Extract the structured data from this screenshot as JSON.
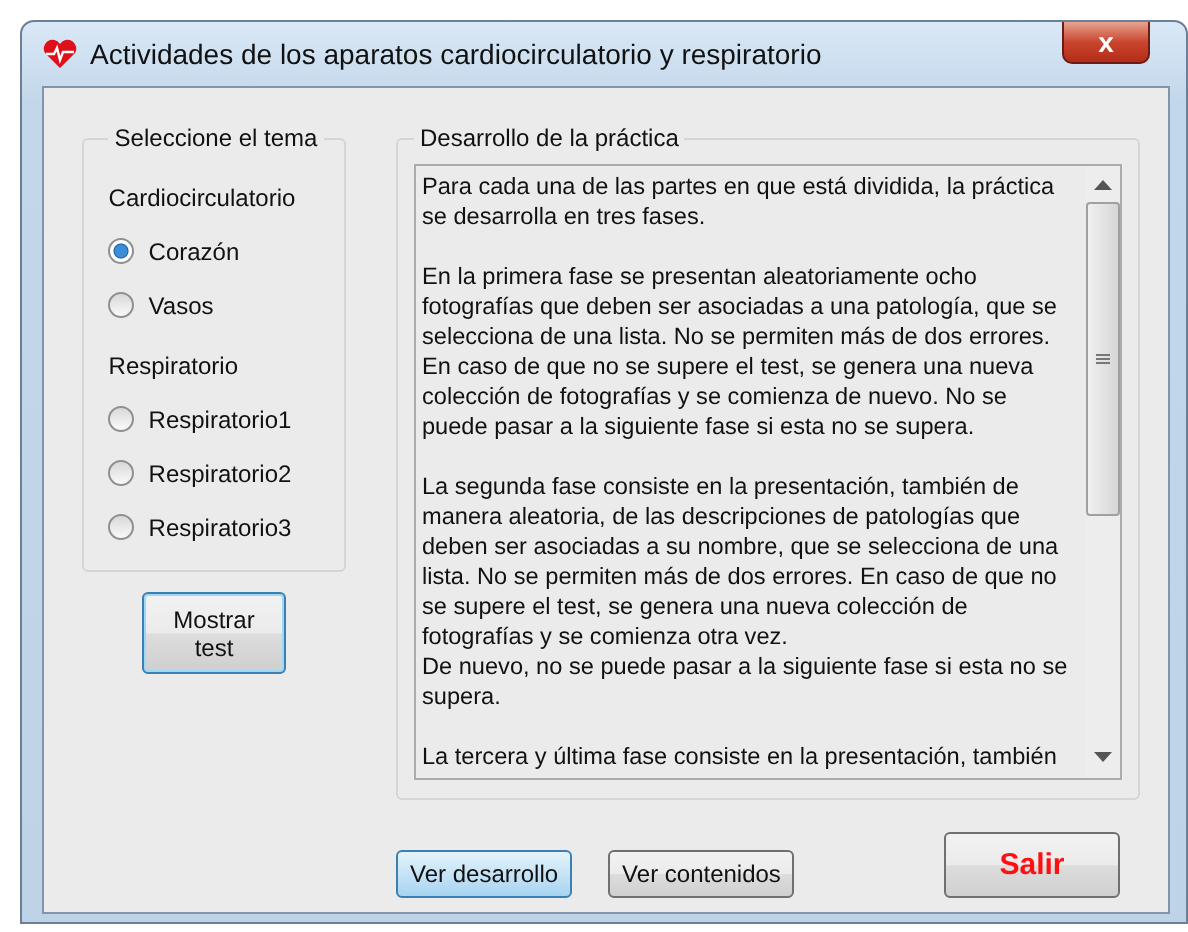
{
  "window": {
    "title": "Actividades de los aparatos cardiocirculatorio y respiratorio",
    "close": "x"
  },
  "topic_group": {
    "title": "Seleccione el tema",
    "sections": [
      {
        "heading": "Cardiocirculatorio",
        "options": [
          {
            "label": "Corazón",
            "selected": true
          },
          {
            "label": "Vasos",
            "selected": false
          }
        ]
      },
      {
        "heading": "Respiratorio",
        "options": [
          {
            "label": "Respiratorio1",
            "selected": false
          },
          {
            "label": "Respiratorio2",
            "selected": false
          },
          {
            "label": "Respiratorio3",
            "selected": false
          }
        ]
      }
    ]
  },
  "test_button": {
    "lines": [
      "Mostrar",
      "test"
    ]
  },
  "practice_group": {
    "title": "Desarrollo de la práctica",
    "paragraphs": [
      [
        "Para cada una de las partes en que está dividida, la práctica",
        "se desarrolla en tres fases."
      ],
      [
        "En la primera fase se presentan aleatoriamente ocho",
        "fotografías que deben ser asociadas a una patología, que se",
        "selecciona de una lista. No se permiten más de dos errores.",
        "En caso de que no se supere el test, se genera una nueva",
        "colección de fotografías y se comienza de nuevo. No se",
        "puede pasar a la siguiente fase si esta no se supera."
      ],
      [
        "La segunda fase consiste en la presentación, también de",
        "manera aleatoria, de las descripciones de patologías que",
        "deben ser asociadas a su nombre, que se selecciona de una",
        "lista. No se permiten más de dos errores. En caso de que no",
        "se supere el test, se genera una nueva colección de",
        "fotografías y se comienza otra vez.",
        "De nuevo, no se puede pasar a la siguiente fase si esta no se",
        "supera."
      ],
      [
        "La tercera y última fase consiste en la presentación, también"
      ]
    ]
  },
  "buttons": [
    {
      "label": "Ver desarrollo",
      "kind": "focused"
    },
    {
      "label": "Ver contenidos",
      "kind": "normal"
    },
    {
      "label": "Salir",
      "kind": "exit"
    }
  ]
}
